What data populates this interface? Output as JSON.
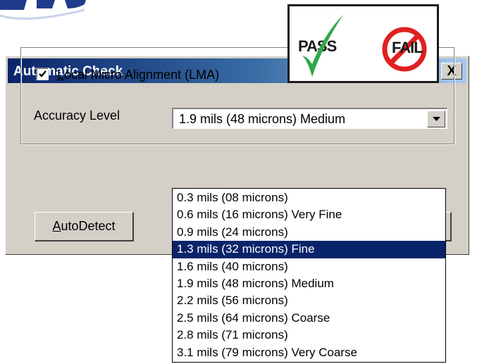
{
  "dialog": {
    "title": "Automatic Check",
    "close_label": "X"
  },
  "lma": {
    "checked": true,
    "label_prefix": "L",
    "label_rest": "ocal Micro Alignment (LMA)"
  },
  "accuracy": {
    "label": "Accuracy Level",
    "selected_value": "1.9 mils (48 microns) Medium",
    "options": [
      "0.3 mils (08 microns)",
      "0.6 mils (16 microns) Very Fine",
      "0.9 mils (24 microns)",
      "1.3 mils (32 microns) Fine",
      "1.6 mils (40 microns)",
      "1.9 mils (48 microns) Medium",
      "2.2 mils (56 microns)",
      "2.5 mils (64 microns) Coarse",
      "2.8 mils (71 microns)",
      "3.1 mils (79 microns) Very Coarse"
    ],
    "highlighted_index": 3
  },
  "buttons": {
    "autodetect_prefix": "A",
    "autodetect_rest": "utoDetect"
  },
  "badge": {
    "pass": "PASS",
    "fail": "FAIL"
  },
  "colors": {
    "title_bar": "#0a246a",
    "highlight": "#0a246a",
    "check_green": "#2ea84a",
    "no_red": "#e02020"
  }
}
